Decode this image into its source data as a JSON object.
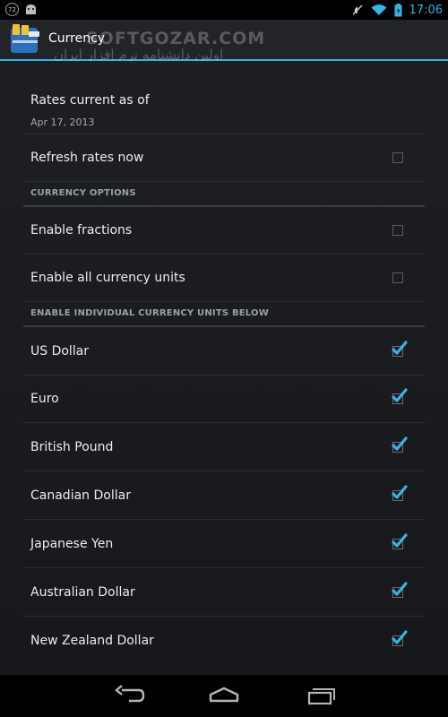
{
  "status_bar": {
    "badge_text": "72",
    "time": "17:06",
    "icons": [
      "notification-badge-icon",
      "android-icon",
      "muted-icon",
      "wifi-icon",
      "battery-icon"
    ]
  },
  "action_bar": {
    "title": "Currency",
    "watermark": "SOFTGOZAR.COM",
    "watermark_sub": "اولین دانشنامه نرم افزار ایران"
  },
  "rates": {
    "title": "Rates current as of",
    "date": "Apr 17, 2013"
  },
  "refresh": {
    "label": "Refresh rates now",
    "checked": false
  },
  "sections": {
    "currency_options": "CURRENCY OPTIONS",
    "individual_units": "ENABLE INDIVIDUAL CURRENCY UNITS BELOW"
  },
  "options": [
    {
      "label": "Enable fractions",
      "checked": false
    },
    {
      "label": "Enable all currency units",
      "checked": false
    }
  ],
  "currencies": [
    {
      "label": "US Dollar",
      "checked": true
    },
    {
      "label": "Euro",
      "checked": true
    },
    {
      "label": "British Pound",
      "checked": true
    },
    {
      "label": "Canadian Dollar",
      "checked": true
    },
    {
      "label": "Japanese Yen",
      "checked": true
    },
    {
      "label": "Australian Dollar",
      "checked": true
    },
    {
      "label": "New Zealand Dollar",
      "checked": true
    }
  ],
  "colors": {
    "accent": "#33b5e5",
    "check": "#33b5e5"
  }
}
